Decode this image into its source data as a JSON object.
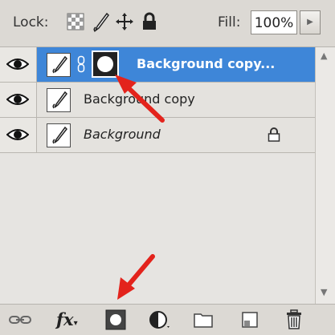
{
  "panel": {
    "lock_label": "Lock:",
    "fill_label": "Fill:",
    "fill_value": "100%"
  },
  "layers": [
    {
      "name": "Background copy...",
      "selected": true,
      "has_mask": true,
      "italic": false,
      "locked": false
    },
    {
      "name": "Background copy",
      "selected": false,
      "has_mask": false,
      "italic": false,
      "locked": false
    },
    {
      "name": "Background",
      "selected": false,
      "has_mask": false,
      "italic": true,
      "locked": true
    }
  ],
  "bottom_toolbar": {
    "fx_label": "fx",
    "buttons": [
      "link-layers-icon",
      "fx-icon",
      "add-layer-mask-icon",
      "adjustment-layer-icon",
      "new-group-icon",
      "new-layer-icon",
      "trash-icon"
    ]
  },
  "colors": {
    "selection_blue": "#3e86d8",
    "annotation_red": "#e3231c"
  }
}
